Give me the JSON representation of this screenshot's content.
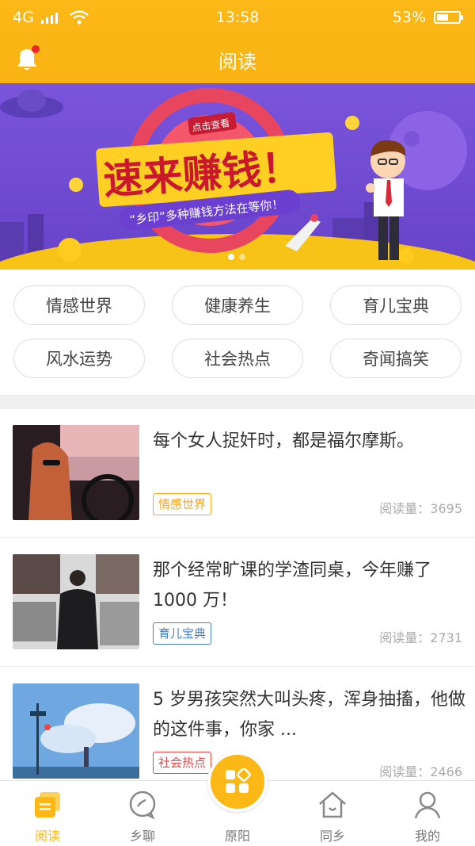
{
  "status_bar": {
    "network": "4G",
    "time": "13:58",
    "battery": "53%",
    "battery_level": 0.53
  },
  "header": {
    "title": "阅读",
    "has_notification": true
  },
  "banner": {
    "badge": "点击查看",
    "headline": "速来赚钱！",
    "subline": "“乡印”多种赚钱方法在等你！",
    "slide_count": 2,
    "active_slide": 1
  },
  "categories": [
    "情感世界",
    "健康养生",
    "育儿宝典",
    "风水运势",
    "社会热点",
    "奇闻搞笑"
  ],
  "articles": [
    {
      "title": "每个女人捉奸时，都是福尔摩斯。",
      "tag": "情感世界",
      "tag_color": "#f5a623",
      "views_label": "阅读量：",
      "views": "3695"
    },
    {
      "title": "那个经常旷课的学渣同桌，今年赚了 1000 万！",
      "tag": "育儿宝典",
      "tag_color": "#4a7fc1",
      "views_label": "阅读量：",
      "views": "2731"
    },
    {
      "title": "5 岁男孩突然大叫头疼，浑身抽搐，他做的这件事，你家 ...",
      "tag": "社会热点",
      "tag_color": "#e84a4a",
      "views_label": "阅读量：",
      "views": "2466"
    }
  ],
  "nav": {
    "items": [
      {
        "label": "阅读",
        "icon": "read-icon",
        "active": true
      },
      {
        "label": "乡聊",
        "icon": "chat-icon"
      },
      {
        "label": "原阳",
        "icon": "apps-icon"
      },
      {
        "label": "同乡",
        "icon": "home-icon"
      },
      {
        "label": "我的",
        "icon": "user-icon"
      }
    ]
  },
  "colors": {
    "brand": "#fcb816",
    "banner_bg": "#7b55d8",
    "inactive": "#777777"
  }
}
